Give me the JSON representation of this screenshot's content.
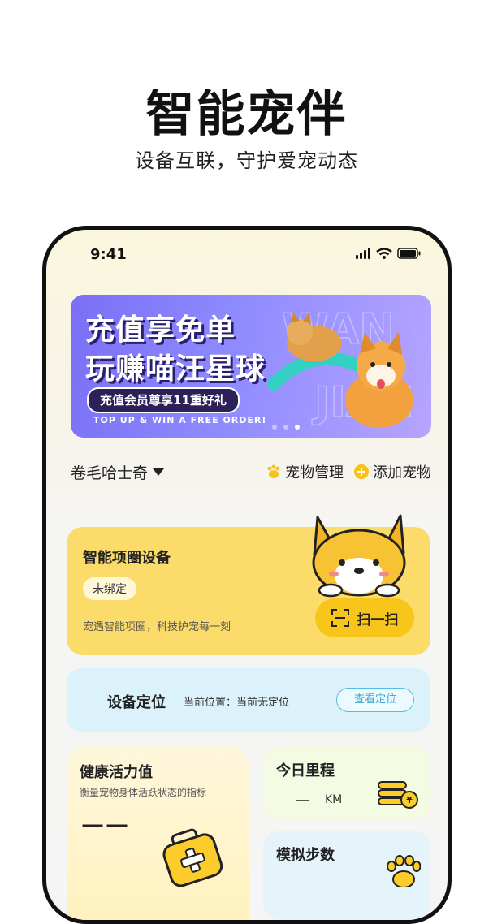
{
  "hero": {
    "title": "智能宠伴",
    "subtitle": "设备互联，守护爱宠动态"
  },
  "status_bar": {
    "time": "9:41",
    "icons": [
      "signal-icon",
      "wifi-icon",
      "battery-icon"
    ]
  },
  "banner": {
    "line1": "充值享免单",
    "line2": "玩赚喵汪星球",
    "pill": "充值会员尊享11重好礼",
    "english": "TOP UP & WIN A FREE ORDER!",
    "dots": 3,
    "active_dot": 3
  },
  "pet_row": {
    "pet_name": "卷毛哈士奇",
    "manage_label": "宠物管理",
    "add_label": "添加宠物"
  },
  "collar_card": {
    "title": "智能项圈设备",
    "badge": "未绑定",
    "description": "宠遇智能项圈，科技护宠每一刻",
    "scan_label": "扫一扫"
  },
  "location_card": {
    "title": "设备定位",
    "current": "当前位置：当前无定位",
    "button": "查看定位"
  },
  "health_card": {
    "title": "健康活力值",
    "description": "衡量宠物身体活跃状态的指标",
    "value": "——"
  },
  "mileage_card": {
    "title": "今日里程",
    "value": "—",
    "unit": "KM"
  },
  "steps_card": {
    "title": "模拟步数"
  },
  "colors": {
    "collar_card": "#fbdb6a",
    "scan_button": "#f8c61a",
    "location_card": "#dcf2fb",
    "location_button": "#3aa9d6",
    "banner": "#8f8bff"
  }
}
